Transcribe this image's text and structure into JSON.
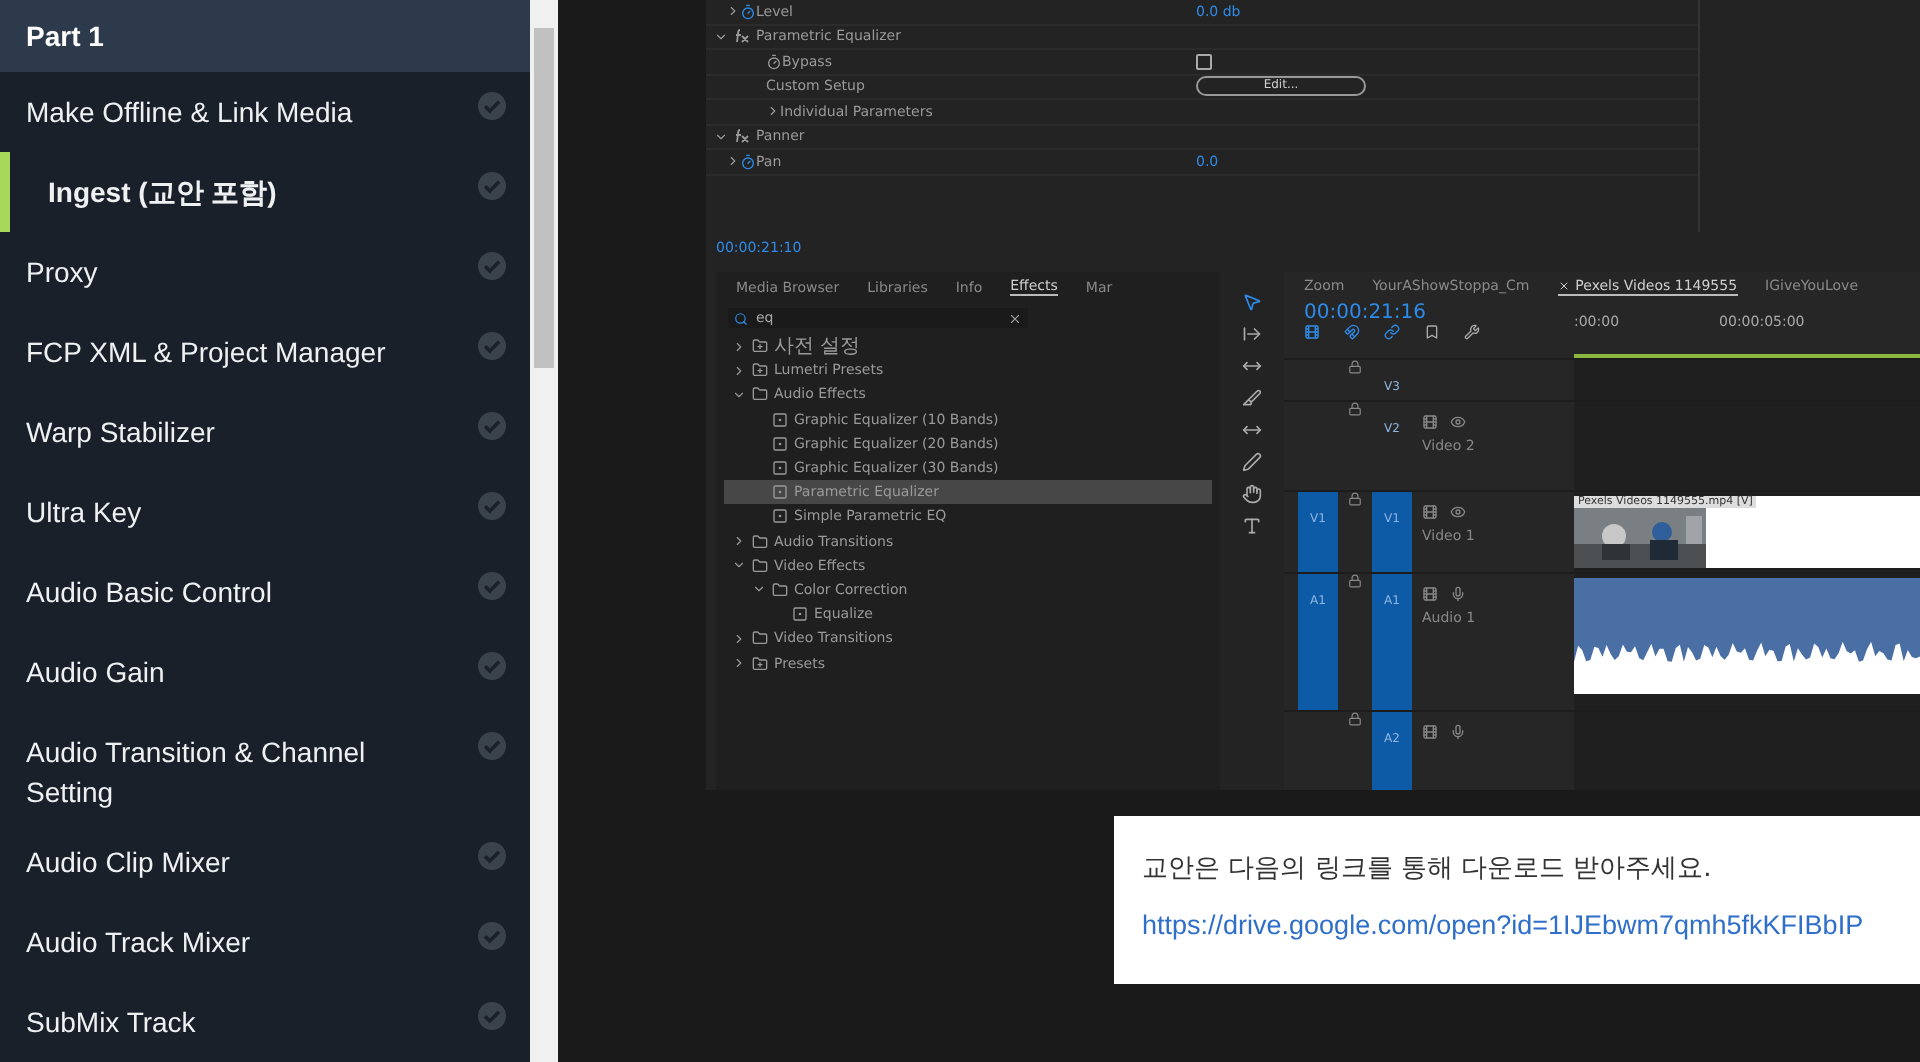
{
  "sidebar": {
    "section": "Part 1",
    "items": [
      {
        "label": "Make Offline & Link Media",
        "selected": false
      },
      {
        "label": "Ingest (교안 포함)",
        "selected": true
      },
      {
        "label": "Proxy",
        "selected": false
      },
      {
        "label": "FCP XML & Project Manager",
        "selected": false
      },
      {
        "label": "Warp Stabilizer",
        "selected": false
      },
      {
        "label": "Ultra Key",
        "selected": false
      },
      {
        "label": "Audio Basic Control",
        "selected": false
      },
      {
        "label": "Audio Gain",
        "selected": false
      },
      {
        "label": "Audio Transition & Channel Setting",
        "selected": false
      },
      {
        "label": "Audio Clip Mixer",
        "selected": false
      },
      {
        "label": "Audio Track Mixer",
        "selected": false
      },
      {
        "label": "SubMix Track",
        "selected": false
      }
    ]
  },
  "editor": {
    "effect_controls": {
      "rows": [
        {
          "kind": "param",
          "label": "Level",
          "value": "0.0 db",
          "expanded": false
        },
        {
          "kind": "effect",
          "label": "Parametric Equalizer",
          "expanded": true
        },
        {
          "kind": "checkbox",
          "label": "Bypass",
          "checked": false
        },
        {
          "kind": "button",
          "label": "Custom Setup",
          "button": "Edit..."
        },
        {
          "kind": "group",
          "label": "Individual Parameters",
          "expanded": false
        },
        {
          "kind": "effect",
          "label": "Panner",
          "expanded": true
        },
        {
          "kind": "param",
          "label": "Pan",
          "value": "0.0",
          "expanded": false
        }
      ],
      "timecode": "00:00:21:10"
    },
    "effects_panel": {
      "tabs": [
        {
          "label": "Media Browser",
          "selected": false
        },
        {
          "label": "Libraries",
          "selected": false
        },
        {
          "label": "Info",
          "selected": false
        },
        {
          "label": "Effects",
          "selected": true
        },
        {
          "label": "Mar",
          "selected": false
        }
      ],
      "search": "eq",
      "tree": [
        {
          "label": "사전 설정",
          "kind": "preset-bin",
          "expanded": false,
          "selected": false
        },
        {
          "label": "Lumetri Presets",
          "kind": "preset-bin",
          "expanded": false,
          "selected": false
        },
        {
          "label": "Audio Effects",
          "kind": "bin",
          "expanded": true,
          "selected": false,
          "children": [
            {
              "label": "Graphic Equalizer (10 Bands)",
              "kind": "effect",
              "selected": false
            },
            {
              "label": "Graphic Equalizer (20 Bands)",
              "kind": "effect",
              "selected": false
            },
            {
              "label": "Graphic Equalizer (30 Bands)",
              "kind": "effect",
              "selected": false
            },
            {
              "label": "Parametric Equalizer",
              "kind": "effect",
              "selected": true
            },
            {
              "label": "Simple Parametric EQ",
              "kind": "effect",
              "selected": false
            }
          ]
        },
        {
          "label": "Audio Transitions",
          "kind": "bin",
          "expanded": false,
          "selected": false
        },
        {
          "label": "Video Effects",
          "kind": "bin",
          "expanded": true,
          "selected": false,
          "children": [
            {
              "label": "Color Correction",
              "kind": "bin",
              "expanded": true,
              "selected": false,
              "children": [
                {
                  "label": "Equalize",
                  "kind": "effect",
                  "selected": false
                }
              ]
            }
          ]
        },
        {
          "label": "Video Transitions",
          "kind": "bin",
          "expanded": false,
          "selected": false
        },
        {
          "label": "Presets",
          "kind": "preset-bin",
          "expanded": false,
          "selected": false
        }
      ]
    },
    "timeline": {
      "tabs": [
        {
          "label": "Zoom",
          "selected": false
        },
        {
          "label": "YourAShowStoppa_Cm",
          "selected": false
        },
        {
          "label": "Pexels Videos 1149555",
          "selected": true
        },
        {
          "label": "IGiveYouLove",
          "selected": false
        }
      ],
      "timecode": "00:00:21:16",
      "ruler": [
        ":00:00",
        "00:00:05:00"
      ],
      "tracks": [
        {
          "id": "V3",
          "kind": "video"
        },
        {
          "id": "V2",
          "kind": "video",
          "name": "Video 2"
        },
        {
          "id": "V1",
          "kind": "video",
          "name": "Video 1",
          "source": "V1",
          "clip": "Pexels Videos 1149555.mp4 [V]"
        },
        {
          "id": "A1",
          "kind": "audio",
          "name": "Audio 1",
          "source": "A1"
        },
        {
          "id": "A2",
          "kind": "audio"
        }
      ]
    }
  },
  "note": {
    "text": "교안은 다음의 링크를 통해 다운로드 받아주세요.",
    "link": "https://drive.google.com/open?id=1IJEbwm7qmh5fkKFIBbIP"
  }
}
